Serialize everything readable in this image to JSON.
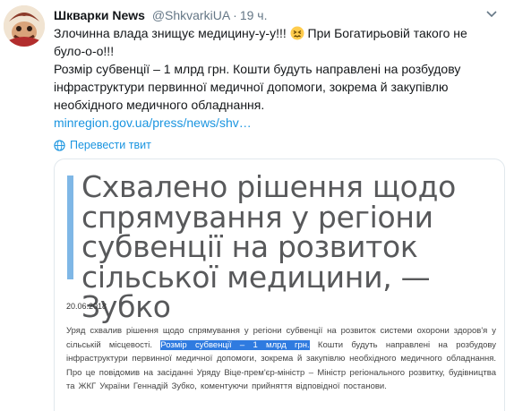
{
  "tweet": {
    "author_name": "Шкварки News",
    "author_handle": "@ShkvarkiUA",
    "separator": "·",
    "time": "19 ч.",
    "text_line1_part1": "Злочинна влада знищує медицину-у-у!!! ",
    "text_line1_part2": " При Богатирьовій такого не було-о-о!!!",
    "text_para2": "Розмір субвенції – 1 млрд грн. Кошти будуть направлені на розбудову інфраструктури первинної медичної допомоги, зокрема й закупівлю необхідного медичного обладнання.",
    "link_text": "minregion.gov.ua/press/news/shv…",
    "translate_label": "Перевести твит"
  },
  "icons": {
    "avatar": "avatar-image",
    "emoji": "persevering-face-emoji",
    "caret": "chevron-down-icon",
    "translate": "globe-icon"
  },
  "card": {
    "title": "Схвалено рішення щодо спрямування у регіони субвенції на розвиток сільської медицини, — Зубко",
    "date": "20.06.2018",
    "body_before": "Уряд схвалив рішення щодо спрямування у регіони субвенції на розвиток системи охорони здоров'я у сільській місцевості. ",
    "body_highlight": "Розмір субвенції – 1 млрд грн.",
    "body_after": " Кошти будуть направлені на розбудову інфраструктури первинної медичної допомоги, зокрема й закупівлю необхідного медичного обладнання. Про це повідомив на засіданні Уряду Віце-прем'єр-міністр – Міністр регіонального розвитку, будівництва та ЖКГ України Геннадій Зубко, коментуючи прийняття відповідної постанови."
  },
  "colors": {
    "link": "#1b95e0",
    "card_accent": "#7fb7e6",
    "highlight": "#2f7be0"
  }
}
